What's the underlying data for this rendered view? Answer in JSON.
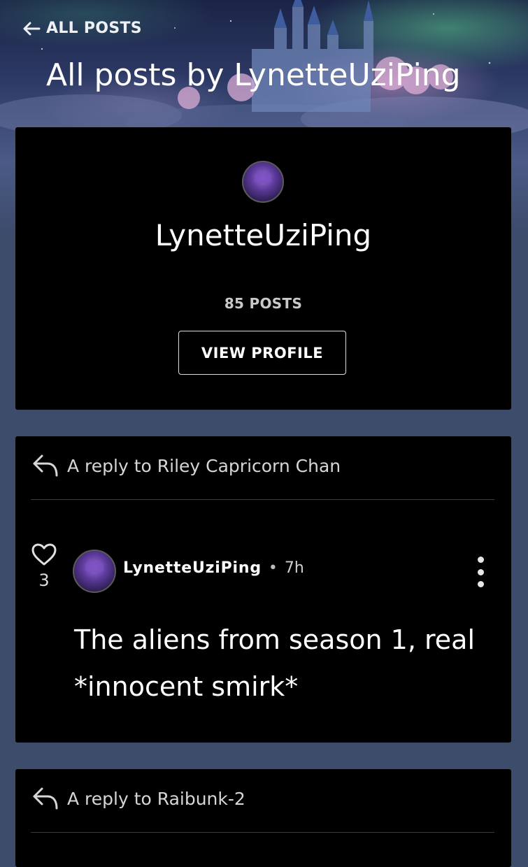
{
  "header": {
    "back_label": "ALL POSTS",
    "title": "All posts by LynetteUziPing"
  },
  "profile": {
    "name": "LynetteUziPing",
    "post_count": "85 POSTS",
    "view_profile_label": "VIEW PROFILE"
  },
  "posts": [
    {
      "reply_to": "A reply to Riley Capricorn Chan",
      "likes": "3",
      "author": "LynetteUziPing",
      "separator": "•",
      "time": "7h",
      "body": "The aliens from season 1, real *innocent smirk*"
    },
    {
      "reply_to": "A reply to Raibunk-2"
    }
  ],
  "colors": {
    "page_background": "#3d4c6b",
    "card_background": "#000000",
    "text_primary": "#ffffff",
    "text_secondary": "#c9c9c9"
  },
  "icons": {
    "back": "arrow-left-icon",
    "reply": "reply-arrow-icon",
    "like": "heart-outline-icon",
    "more": "vertical-ellipsis-icon"
  }
}
